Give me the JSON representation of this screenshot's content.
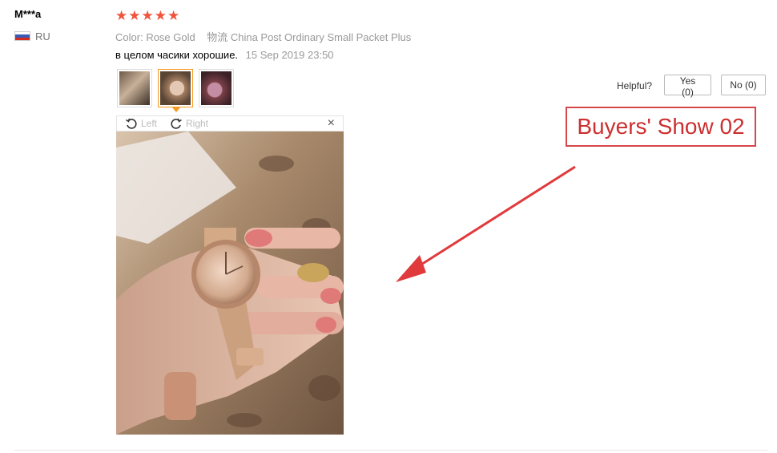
{
  "review": {
    "user_name": "M***a",
    "country": "RU",
    "stars": "★★★★★",
    "color_label": "Color:",
    "color_value": "Rose Gold",
    "shipping_label": "物流",
    "shipping_value": "China Post Ordinary Small Packet Plus",
    "text": "в целом часики хорошие.",
    "date": "15 Sep 2019 23:50"
  },
  "viewer": {
    "rotate_left": "Left",
    "rotate_right": "Right",
    "close": "×"
  },
  "helpful": {
    "label": "Helpful?",
    "yes": "Yes (0)",
    "no": "No (0)"
  },
  "annotation": {
    "text": "Buyers' Show 02"
  },
  "colors": {
    "star": "#f0533c",
    "active_thumb": "#f59a23",
    "annotation_red": "#d6464a"
  }
}
